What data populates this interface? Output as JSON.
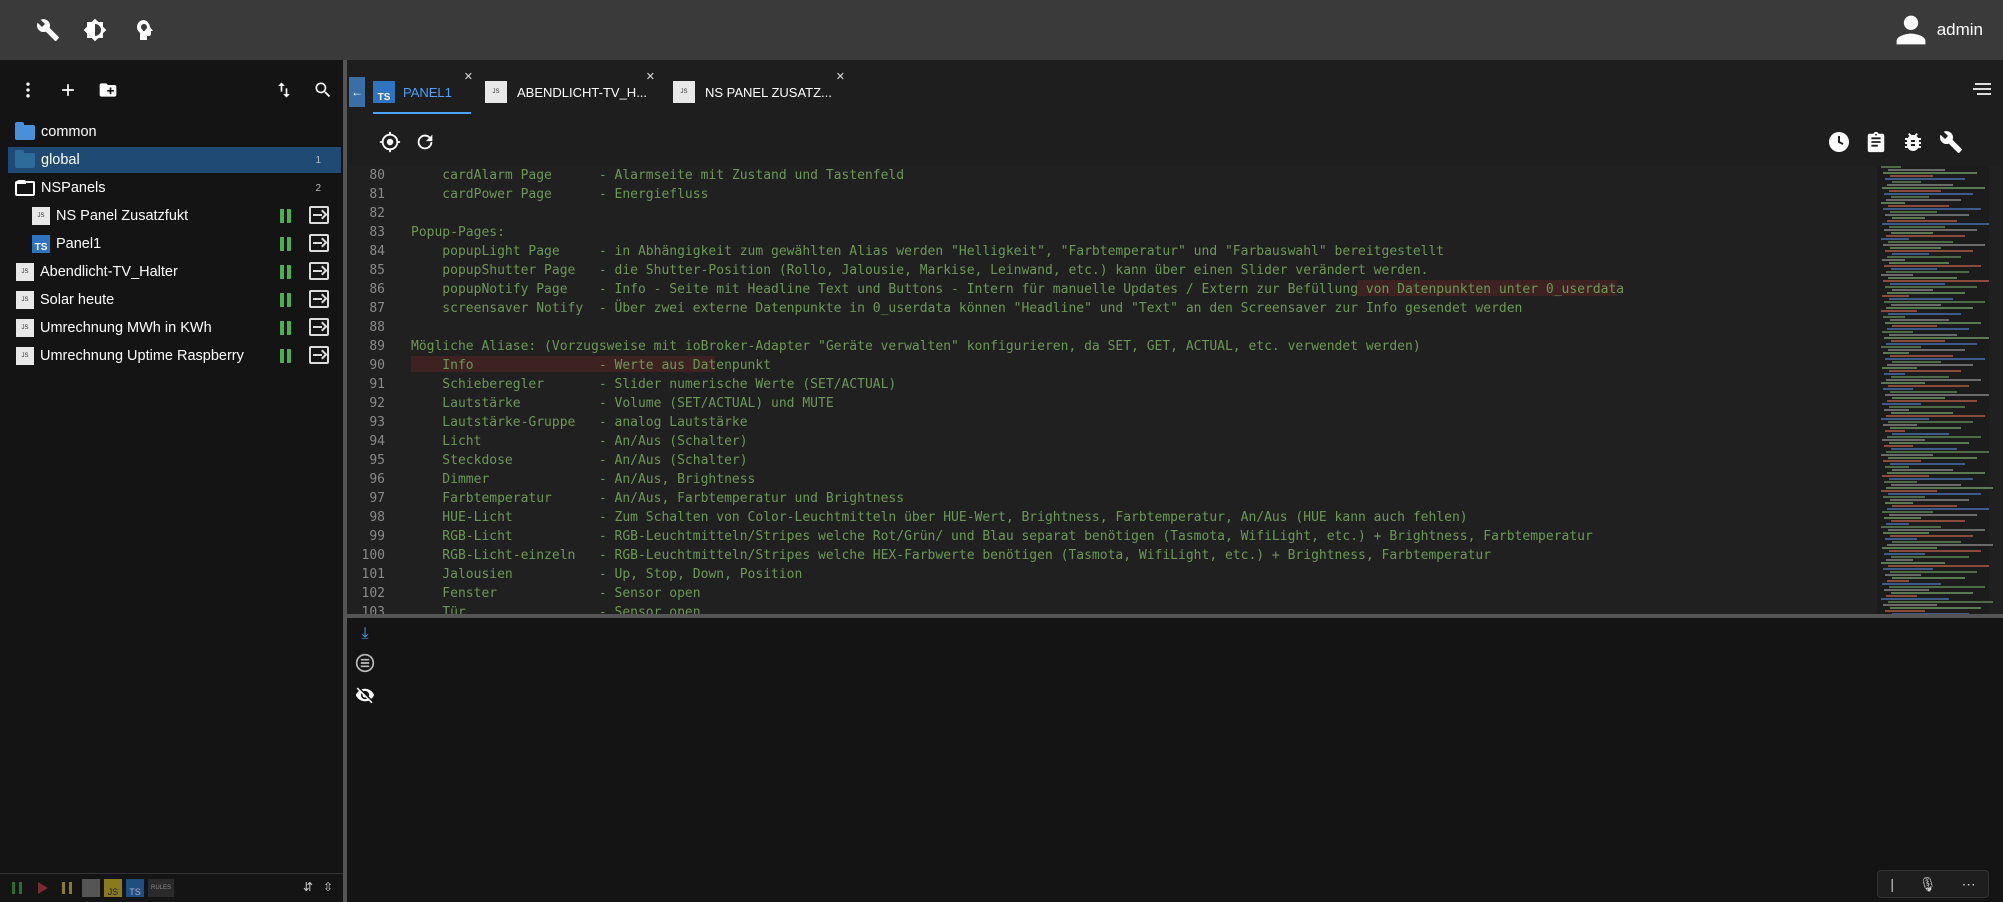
{
  "user": {
    "name": "admin"
  },
  "topbar": {
    "icons": [
      "wrench-icon",
      "settings-brightness-icon",
      "head-bulb-icon"
    ]
  },
  "sidebar": {
    "toolbar_icons": [
      "more-vert-icon",
      "add-icon",
      "add-folder-icon",
      "sort-icon",
      "search-icon"
    ],
    "items": [
      {
        "label": "common",
        "type": "folder",
        "count": ""
      },
      {
        "label": "global",
        "type": "folder",
        "count": "1",
        "selected": true
      },
      {
        "label": "NSPanels",
        "type": "folder-open",
        "count": "2"
      },
      {
        "label": "NS Panel Zusatzfukt",
        "type": "script-js"
      },
      {
        "label": "Panel1",
        "type": "script-ts"
      },
      {
        "label": "Abendlicht-TV_Halter",
        "type": "script-js"
      },
      {
        "label": "Solar heute",
        "type": "script-js"
      },
      {
        "label": "Umrechnung MWh in KWh",
        "type": "script-js"
      },
      {
        "label": "Umrechnung Uptime Raspberry",
        "type": "script-js"
      }
    ]
  },
  "tabs": [
    {
      "label": "PANEL1",
      "type": "ts",
      "active": true
    },
    {
      "label": "ABENDLICHT-TV_H...",
      "type": "js",
      "active": false
    },
    {
      "label": "NS PANEL ZUSATZ...",
      "type": "js",
      "active": false
    }
  ],
  "editor": {
    "lines": [
      {
        "n": "80",
        "text": "    cardAlarm Page      - Alarmseite mit Zustand und Tastenfeld"
      },
      {
        "n": "81",
        "text": "    cardPower Page      - Energiefluss"
      },
      {
        "n": "82",
        "text": ""
      },
      {
        "n": "83",
        "text": "Popup-Pages:"
      },
      {
        "n": "84",
        "text": "    popupLight Page     - in Abhängigkeit zum gewählten Alias werden \"Helligkeit\", \"Farbtemperatur\" und \"Farbauswahl\" bereitgestellt"
      },
      {
        "n": "85",
        "text": "    popupShutter Page   - die Shutter-Position (Rollo, Jalousie, Markise, Leinwand, etc.) kann über einen Slider verändert werden."
      },
      {
        "n": "86",
        "text": "    popupNotify Page    - Info - Seite mit Headline Text und Buttons - Intern für manuelle Updates / Extern zur Befüllung von Datenpunkten unter 0_userdata"
      },
      {
        "n": "87",
        "text": "    screensaver Notify  - Über zwei externe Datenpunkte in 0_userdata können \"Headline\" und \"Text\" an den Screensaver zur Info gesendet werden"
      },
      {
        "n": "88",
        "text": ""
      },
      {
        "n": "89",
        "text": "Mögliche Aliase: (Vorzugsweise mit ioBroker-Adapter \"Geräte verwalten\" konfigurieren, da SET, GET, ACTUAL, etc. verwendet werden)"
      },
      {
        "n": "90",
        "text": "    Info                - Werte aus Datenpunkt"
      },
      {
        "n": "91",
        "text": "    Schieberegler       - Slider numerische Werte (SET/ACTUAL)"
      },
      {
        "n": "92",
        "text": "    Lautstärke          - Volume (SET/ACTUAL) und MUTE"
      },
      {
        "n": "93",
        "text": "    Lautstärke-Gruppe   - analog Lautstärke"
      },
      {
        "n": "94",
        "text": "    Licht               - An/Aus (Schalter)"
      },
      {
        "n": "95",
        "text": "    Steckdose           - An/Aus (Schalter)"
      },
      {
        "n": "96",
        "text": "    Dimmer              - An/Aus, Brightness"
      },
      {
        "n": "97",
        "text": "    Farbtemperatur      - An/Aus, Farbtemperatur und Brightness"
      },
      {
        "n": "98",
        "text": "    HUE-Licht           - Zum Schalten von Color-Leuchtmitteln über HUE-Wert, Brightness, Farbtemperatur, An/Aus (HUE kann auch fehlen)"
      },
      {
        "n": "99",
        "text": "    RGB-Licht           - RGB-Leuchtmitteln/Stripes welche Rot/Grün/ und Blau separat benötigen (Tasmota, WifiLight, etc.) + Brightness, Farbtemperatur"
      },
      {
        "n": "100",
        "text": "    RGB-Licht-einzeln   - RGB-Leuchtmitteln/Stripes welche HEX-Farbwerte benötigen (Tasmota, WifiLight, etc.) + Brightness, Farbtemperatur"
      },
      {
        "n": "101",
        "text": "    Jalousien           - Up, Stop, Down, Position"
      },
      {
        "n": "102",
        "text": "    Fenster             - Sensor open"
      },
      {
        "n": "103",
        "text": "    Tür                 - Sensor open"
      }
    ]
  },
  "colors": {
    "comment": "#6a9955",
    "accent": "#4aa3ff",
    "selected": "#1e4a73",
    "running": "#4caf50"
  }
}
